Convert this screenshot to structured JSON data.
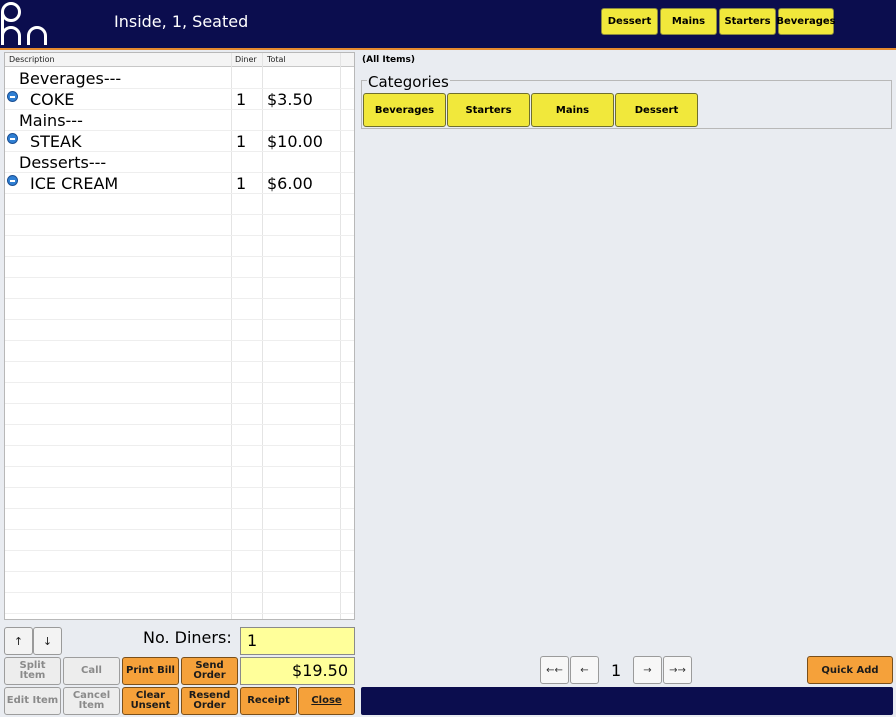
{
  "header": {
    "title": "Inside, 1, Seated",
    "quick_buttons": [
      "Dessert",
      "Mains",
      "Starters",
      "Beverages"
    ]
  },
  "order_grid": {
    "columns": [
      "Description",
      "Diner",
      "Total"
    ],
    "rows": [
      {
        "type": "group",
        "description": "Beverages---"
      },
      {
        "type": "item",
        "description": "COKE",
        "diner": "1",
        "total": "$3.50"
      },
      {
        "type": "group",
        "description": "Mains---"
      },
      {
        "type": "item",
        "description": "STEAK",
        "diner": "1",
        "total": "$10.00"
      },
      {
        "type": "group",
        "description": "Desserts---"
      },
      {
        "type": "item",
        "description": "ICE CREAM",
        "diner": "1",
        "total": "$6.00"
      }
    ]
  },
  "controls": {
    "up_arrow": "↑",
    "down_arrow": "↓",
    "diners_label": "No. Diners:",
    "diners_value": "1",
    "total_value": "$19.50",
    "buttons": {
      "split_item": "Split Item",
      "call": "Call",
      "print_bill": "Print  Bill",
      "send_order": "Send Order",
      "edit_item": "Edit Item",
      "cancel_item": "Cancel Item",
      "clear_unsent": "Clear Unsent",
      "resend_order": "Resend Order",
      "receipt": "Receipt",
      "close": "Close"
    }
  },
  "menu_panel": {
    "filter_label": "(All Items)",
    "categories_title": "Categories",
    "categories": [
      "Beverages",
      "Starters",
      "Mains",
      "Dessert"
    ],
    "pager": {
      "first": "←←",
      "prev": "←",
      "page": "1",
      "next": "→",
      "last": "→→"
    },
    "quick_add": "Quick Add"
  },
  "colors": {
    "header_bg": "#0b0d4e",
    "accent_orange": "#f5a13a",
    "yellow_button": "#f1e83b",
    "yellow_field": "#ffff9a"
  }
}
